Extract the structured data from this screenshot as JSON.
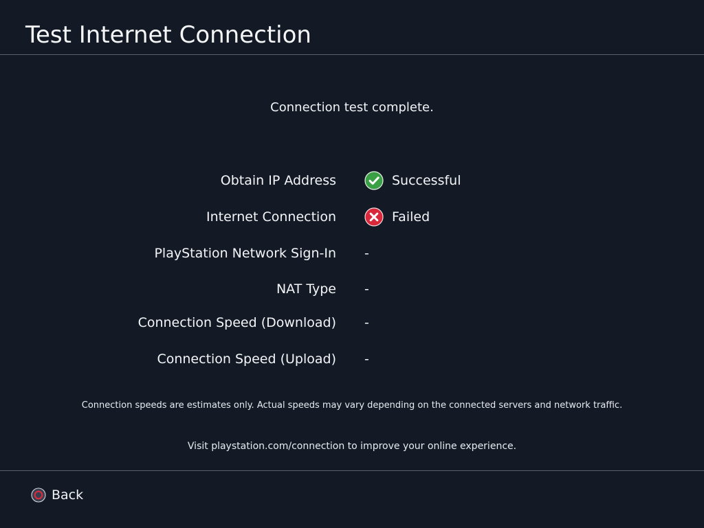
{
  "header": {
    "title": "Test Internet Connection"
  },
  "status": {
    "message": "Connection test complete."
  },
  "results": [
    {
      "label": "Obtain IP Address",
      "value": "Successful",
      "icon": "check-circle-icon"
    },
    {
      "label": "Internet Connection",
      "value": "Failed",
      "icon": "x-circle-icon"
    },
    {
      "label": "PlayStation Network Sign-In",
      "value": "-",
      "icon": ""
    },
    {
      "label": "NAT Type",
      "value": "-",
      "icon": ""
    },
    {
      "label": "Connection Speed (Download)",
      "value": "-",
      "icon": ""
    },
    {
      "label": "Connection Speed (Upload)",
      "value": "-",
      "icon": ""
    }
  ],
  "notes": {
    "speed_estimate": "Connection speeds are estimates only. Actual speeds may vary depending on the connected servers and network traffic.",
    "visit": "Visit playstation.com/connection to improve your online experience."
  },
  "footer": {
    "back_label": "Back",
    "back_icon": "circle-button-icon"
  },
  "colors": {
    "background": "#141a25",
    "success": "#3b9f45",
    "failure": "#d8283a",
    "circle_button": "#d82b3f",
    "divider": "#5a616c"
  }
}
